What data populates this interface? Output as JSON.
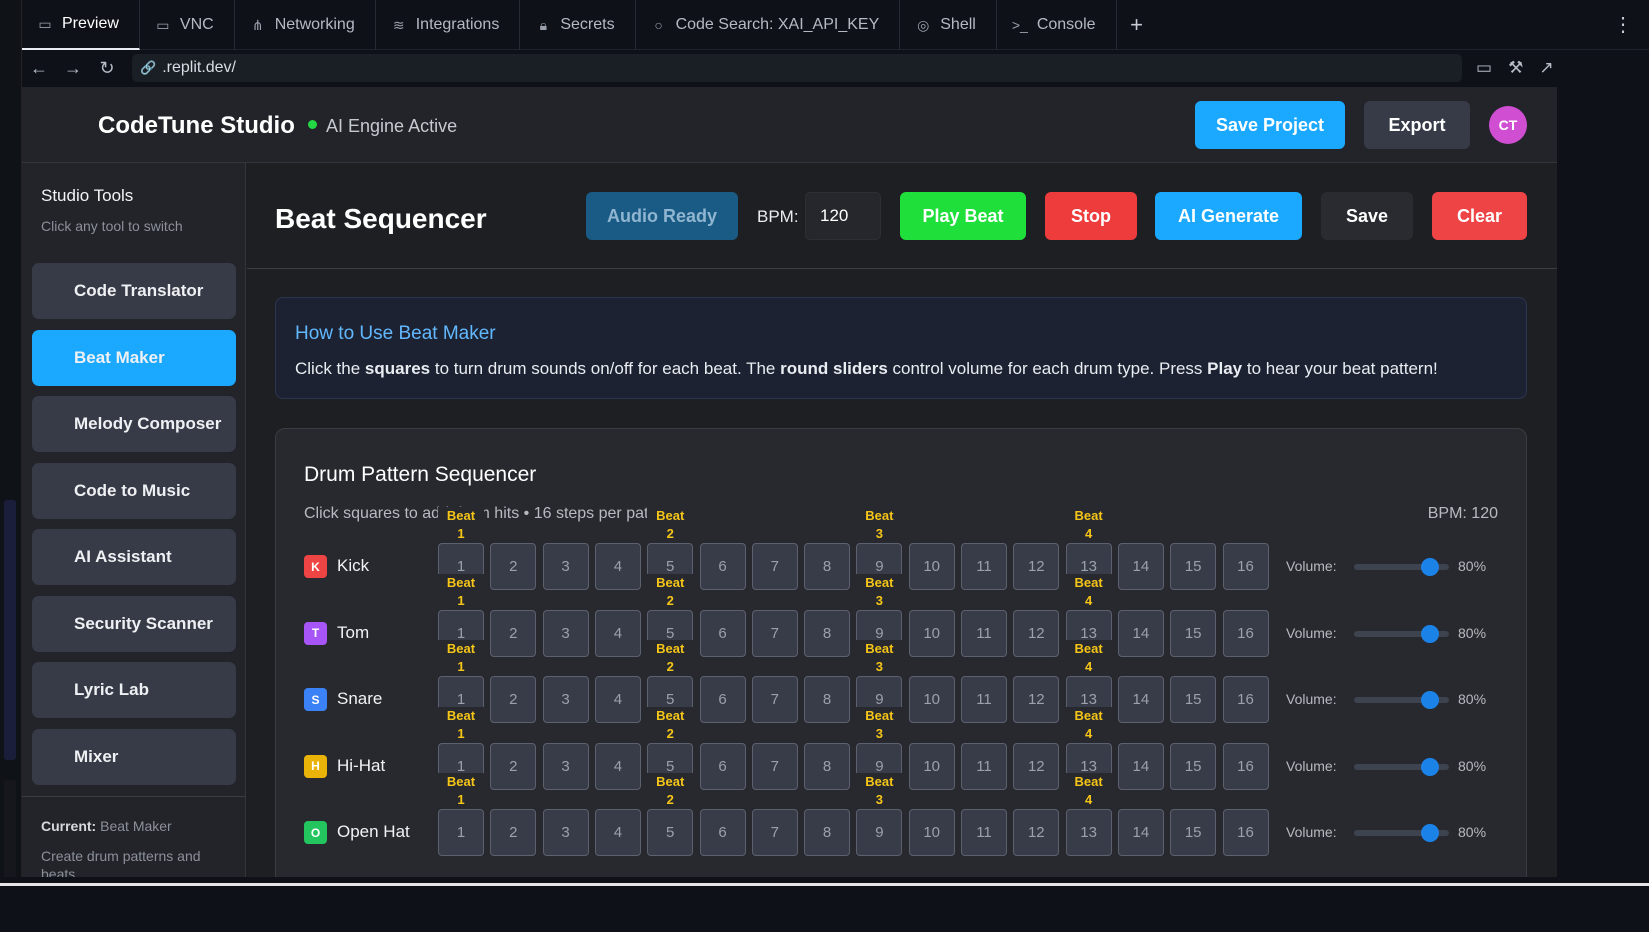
{
  "browser": {
    "tabs": [
      {
        "label": "Preview",
        "icon": "monitor-icon"
      },
      {
        "label": "VNC",
        "icon": "display-icon"
      },
      {
        "label": "Networking",
        "icon": "network-icon"
      },
      {
        "label": "Integrations",
        "icon": "layers-icon"
      },
      {
        "label": "Secrets",
        "icon": "lock-icon"
      },
      {
        "label": "Code Search: XAI_API_KEY",
        "icon": "search-icon"
      },
      {
        "label": "Shell",
        "icon": "shell-icon"
      },
      {
        "label": "Console",
        "icon": "terminal-icon"
      }
    ],
    "add_tab": "+",
    "menu": "⋮",
    "url": ".replit.dev/"
  },
  "header": {
    "brand": "CodeTune Studio",
    "status": "AI Engine Active",
    "save_project": "Save Project",
    "export": "Export",
    "avatar": "CT",
    "status_color": "#22d845"
  },
  "sidebar": {
    "title": "Studio Tools",
    "subtitle": "Click any tool to switch",
    "items": [
      {
        "label": "Code Translator",
        "active": false
      },
      {
        "label": "Beat Maker",
        "active": true
      },
      {
        "label": "Melody Composer",
        "active": false
      },
      {
        "label": "Code to Music",
        "active": false
      },
      {
        "label": "AI Assistant",
        "active": false
      },
      {
        "label": "Security Scanner",
        "active": false
      },
      {
        "label": "Lyric Lab",
        "active": false
      },
      {
        "label": "Mixer",
        "active": false
      }
    ],
    "current_label": "Current:",
    "current_value": "Beat Maker",
    "description": "Create drum patterns and beats"
  },
  "main": {
    "title": "Beat Sequencer",
    "audio_ready": "Audio Ready",
    "bpm_label": "BPM:",
    "bpm_value": "120",
    "play": "Play Beat",
    "stop": "Stop",
    "ai_generate": "AI Generate",
    "save": "Save",
    "clear": "Clear"
  },
  "howto": {
    "title": "How to Use Beat Maker",
    "t1": "Click the ",
    "b1": "squares",
    "t2": " to turn drum sounds on/off for each beat. The ",
    "b2": "round sliders",
    "t3": " control volume for each drum type. Press ",
    "b3": "Play",
    "t4": " to hear your beat pattern!"
  },
  "sequencer": {
    "title": "Drum Pattern Sequencer",
    "subtitle": "Click squares to add drum hits • 16 steps per pattern",
    "bpm": "BPM: 120",
    "volume_label": "Volume:",
    "steps": [
      "1",
      "2",
      "3",
      "4",
      "5",
      "6",
      "7",
      "8",
      "9",
      "10",
      "11",
      "12",
      "13",
      "14",
      "15",
      "16"
    ],
    "beat_word": "Beat",
    "beat_marks": [
      {
        "step": 1,
        "beat": "1"
      },
      {
        "step": 5,
        "beat": "2"
      },
      {
        "step": 9,
        "beat": "3"
      },
      {
        "step": 13,
        "beat": "4"
      }
    ],
    "drums": [
      {
        "letter": "K",
        "name": "Kick",
        "color": "#ef4444",
        "volume": 80,
        "volume_text": "80%"
      },
      {
        "letter": "T",
        "name": "Tom",
        "color": "#a855f7",
        "volume": 80,
        "volume_text": "80%"
      },
      {
        "letter": "S",
        "name": "Snare",
        "color": "#3b82f6",
        "volume": 80,
        "volume_text": "80%"
      },
      {
        "letter": "H",
        "name": "Hi-Hat",
        "color": "#eab308",
        "volume": 80,
        "volume_text": "80%"
      },
      {
        "letter": "O",
        "name": "Open Hat",
        "color": "#22c55e",
        "volume": 80,
        "volume_text": "80%"
      }
    ]
  }
}
